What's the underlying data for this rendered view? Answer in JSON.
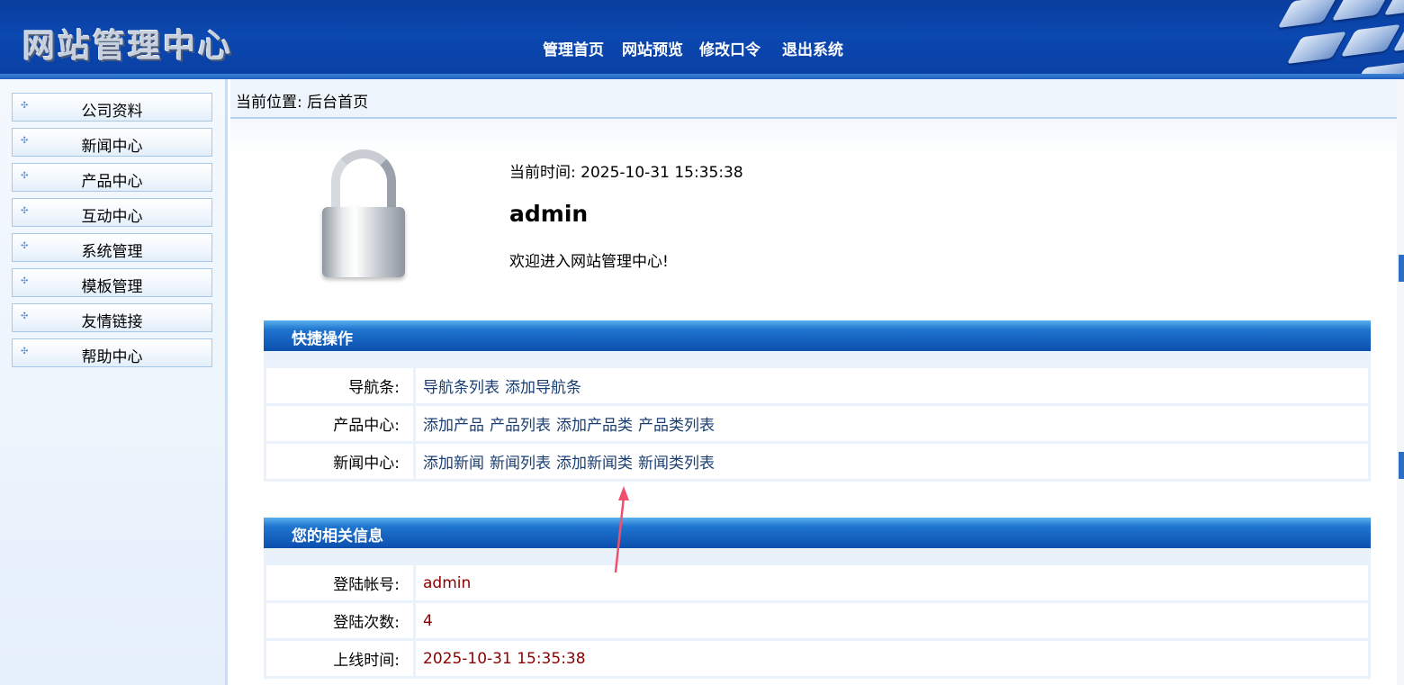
{
  "header": {
    "logo": "网站管理中心",
    "nav": [
      "管理首页",
      "网站预览",
      "修改口令",
      "退出系统"
    ]
  },
  "sidebar": {
    "items": [
      {
        "label": "公司资料"
      },
      {
        "label": "新闻中心"
      },
      {
        "label": "产品中心"
      },
      {
        "label": "互动中心"
      },
      {
        "label": "系统管理"
      },
      {
        "label": "模板管理"
      },
      {
        "label": "友情链接"
      },
      {
        "label": "帮助中心"
      }
    ]
  },
  "breadcrumb": "当前位置: 后台首页",
  "welcome_panel": {
    "time_label": "当前时间:",
    "time_value": "2025-10-31 15:35:38",
    "username": "admin",
    "welcome": "欢迎进入网站管理中心!"
  },
  "quick_ops": {
    "title": "快捷操作",
    "rows": [
      {
        "label": "导航条:",
        "links": [
          "导航条列表",
          "添加导航条"
        ]
      },
      {
        "label": "产品中心:",
        "links": [
          "添加产品",
          "产品列表",
          "添加产品类",
          "产品类列表"
        ]
      },
      {
        "label": "新闻中心:",
        "links": [
          "添加新闻",
          "新闻列表",
          "添加新闻类",
          "新闻类列表"
        ]
      }
    ]
  },
  "user_info": {
    "title": "您的相关信息",
    "rows": [
      {
        "label": "登陆帐号:",
        "value": "admin"
      },
      {
        "label": "登陆次数:",
        "value": "4"
      },
      {
        "label": "上线时间:",
        "value": "2025-10-31 15:35:38"
      }
    ]
  },
  "colors": {
    "header_blue": "#0b48b0",
    "section_bar": "#1f75cf",
    "value_red": "#8b0000",
    "link_blue": "#1a3e72",
    "annotation_arrow": "#f0506e"
  },
  "icons": [
    "lock-icon",
    "menu-dot-icon",
    "annotation-arrow-icon"
  ]
}
